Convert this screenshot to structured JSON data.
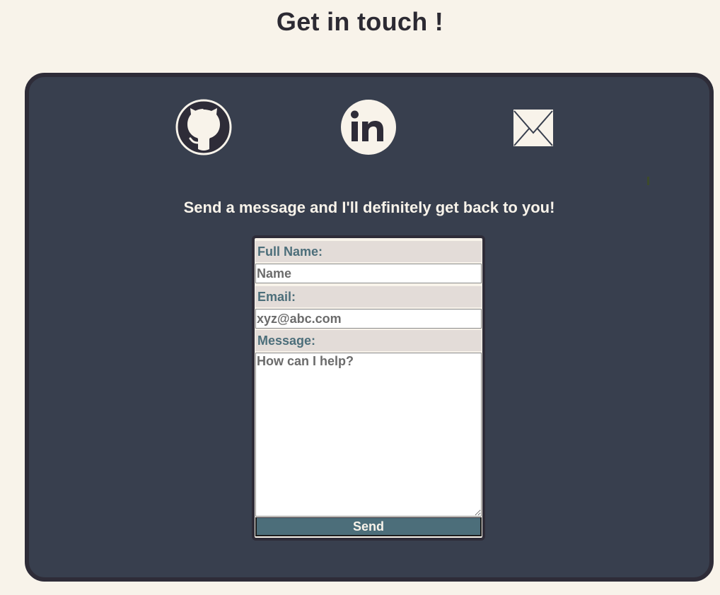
{
  "header": {
    "title": "Get in touch !"
  },
  "social": {
    "github_icon": "github-icon",
    "linkedin_icon": "linkedin-icon",
    "mail_icon": "mail-icon",
    "linkedin_text": "in"
  },
  "contact": {
    "subtitle": "Send a message and I'll definitely get back to you!",
    "name_label": "Full Name:",
    "name_placeholder": "Name",
    "email_label": "Email:",
    "email_placeholder": "xyz@abc.com",
    "message_label": "Message:",
    "message_placeholder": "How can I help?",
    "send_label": "Send"
  },
  "colors": {
    "background": "#f8f3ea",
    "panel": "#383f4e",
    "panel_border": "#2e2c38",
    "label_bg": "#e3dcd8",
    "label_text": "#4c6e7a",
    "button_bg": "#4c6e7a"
  }
}
